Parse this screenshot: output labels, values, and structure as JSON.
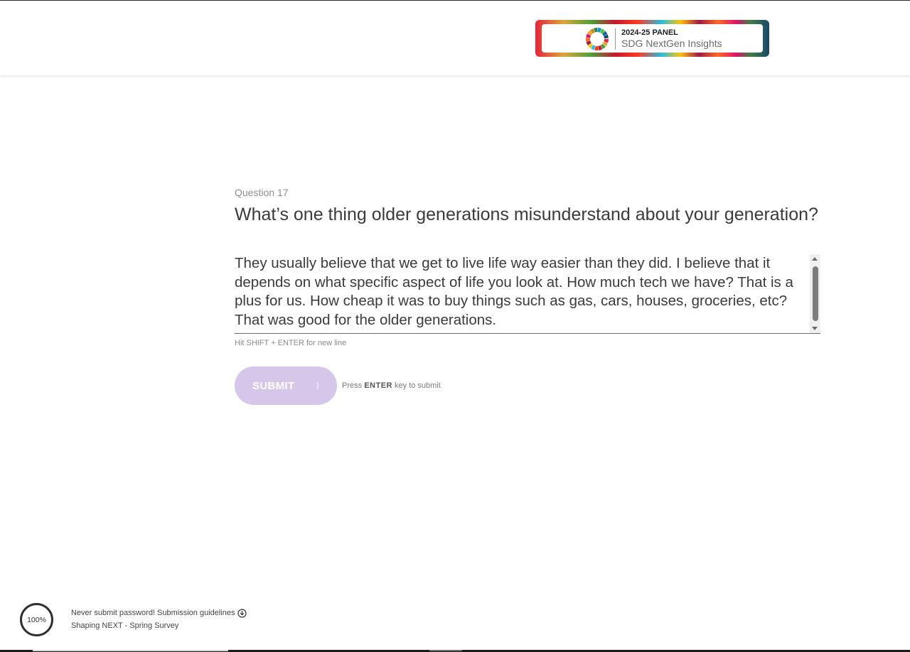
{
  "header": {
    "logo": {
      "line1_prefix": "2024-25 ",
      "line1_bold": "PANEL",
      "line2": "SDG NextGen Insights",
      "wheel_icon": "sdg-wheel-icon"
    }
  },
  "question": {
    "label": "Question 17",
    "title": "What’s one thing older generations misunderstand about your generation?"
  },
  "answer": {
    "value": "They usually believe that we get to live life way easier than they did. I believe that it depends on what specific aspect of life you look at. How much tech we have? That is a plus for us. How cheap it was to buy things such as gas, cars, houses, groceries, etc? That was good for the older generations."
  },
  "hint": "Hit SHIFT + ENTER for new line",
  "submit": {
    "label": "SUBMIT",
    "enter_hint_prefix": "Press ",
    "enter_hint_key": "ENTER",
    "enter_hint_suffix": " key to submit"
  },
  "footer": {
    "progress": "100%",
    "notice": "Never submit password! Submission guidelines",
    "survey_name": "Shaping NEXT - Spring Survey"
  },
  "colors": {
    "submit_bg": "#d6c7ea",
    "text": "#3b3b3b",
    "muted": "#8e8e8e"
  }
}
